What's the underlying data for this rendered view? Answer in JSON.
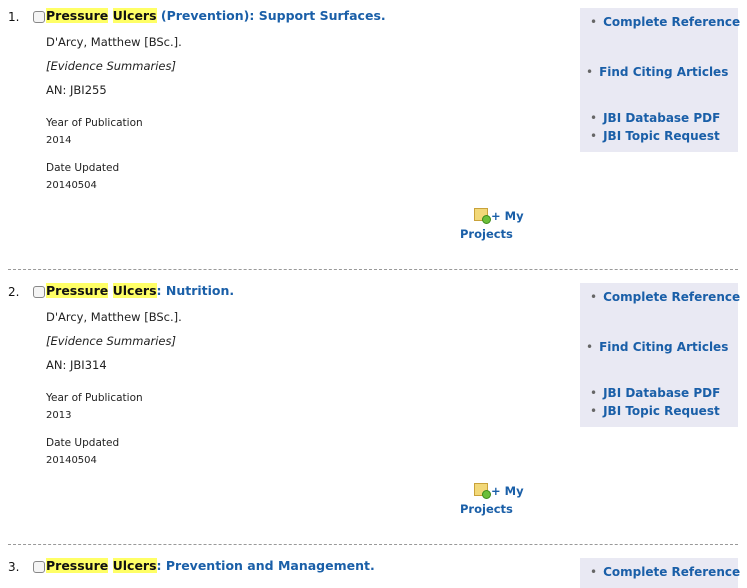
{
  "results": [
    {
      "num": "1.",
      "title_hl1": "Pressure",
      "title_hl2": "Ulcers",
      "title_rest": " (Prevention): Support Surfaces.",
      "author": "D'Arcy, Matthew [BSc.].",
      "pub_type": "[Evidence Summaries]",
      "an_label": "AN:",
      "an_value": "JBI255",
      "year_label": "Year of Publication",
      "year_value": "2014",
      "updated_label": "Date Updated",
      "updated_value": "20140504",
      "projects_line1": "+ My",
      "projects_line2": "Projects"
    },
    {
      "num": "2.",
      "title_hl1": "Pressure",
      "title_hl2": "Ulcers",
      "title_rest": ": Nutrition.",
      "author": "D'Arcy, Matthew [BSc.].",
      "pub_type": "[Evidence Summaries]",
      "an_label": "AN:",
      "an_value": "JBI314",
      "year_label": "Year of Publication",
      "year_value": "2013",
      "updated_label": "Date Updated",
      "updated_value": "20140504",
      "projects_line1": "+ My",
      "projects_line2": "Projects"
    },
    {
      "num": "3.",
      "title_hl1": "Pressure",
      "title_hl2": "Ulcers",
      "title_rest": ": Prevention and Management."
    }
  ],
  "links": {
    "complete_reference": "Complete Reference",
    "find_citing": "Find Citing Articles",
    "jbi_pdf": "JBI Database PDF",
    "jbi_topic": "JBI Topic Request"
  },
  "bullet": "•",
  "colors": {
    "link": "#1a5fa8",
    "highlight": "#ffff66",
    "sidebar_bg": "#e9e9f3"
  }
}
